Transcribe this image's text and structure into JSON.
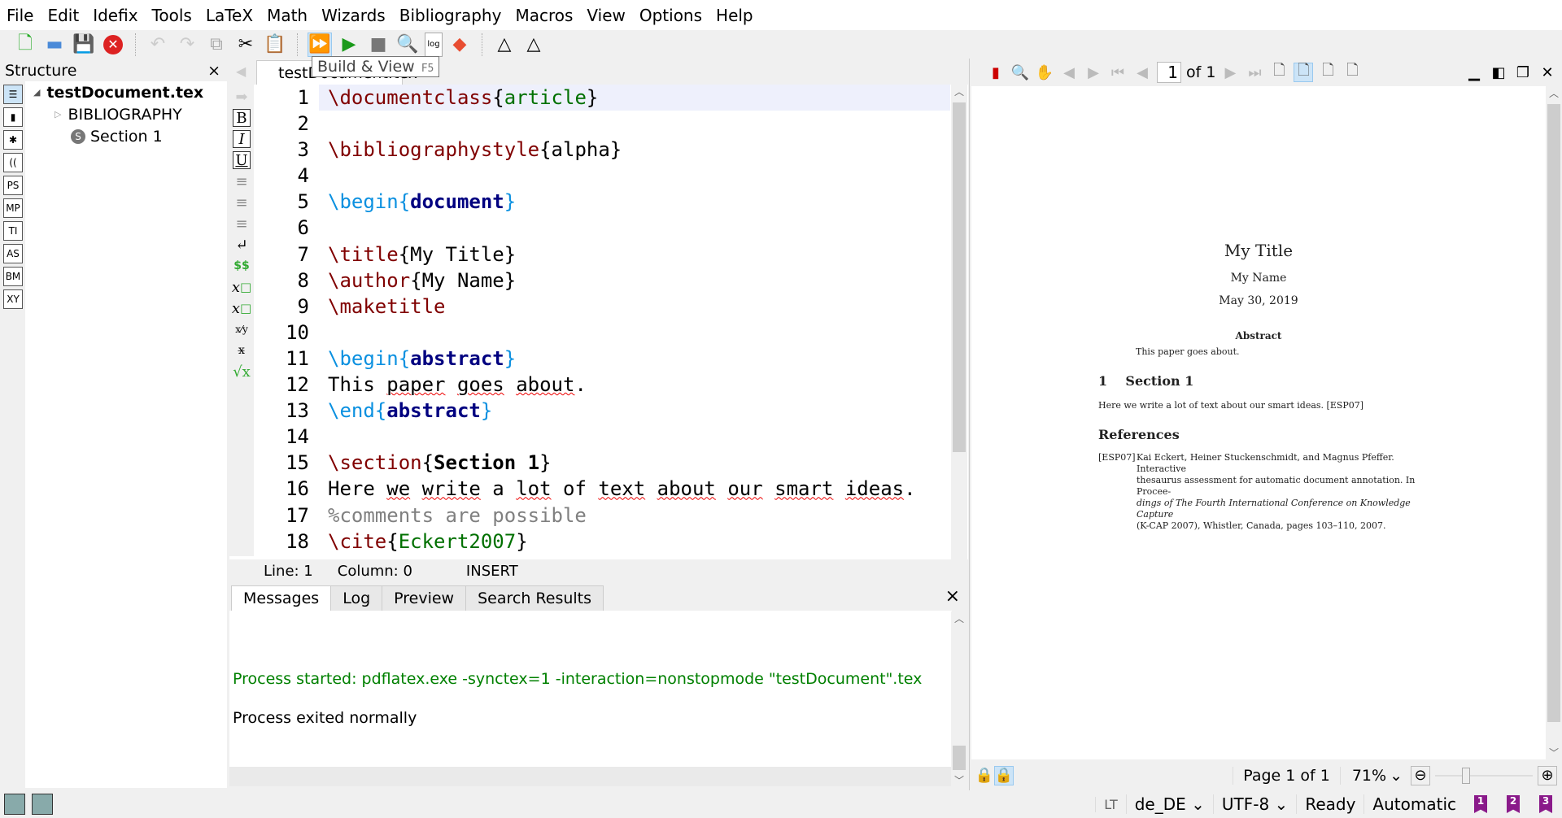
{
  "menu": [
    "File",
    "Edit",
    "Idefix",
    "Tools",
    "LaTeX",
    "Math",
    "Wizards",
    "Bibliography",
    "Macros",
    "View",
    "Options",
    "Help"
  ],
  "tooltip": {
    "label": "Build & View",
    "shortcut": "F5"
  },
  "structure": {
    "title": "Structure",
    "close": "×",
    "side_icons": [
      "PS",
      "MP",
      "TI",
      "AS",
      "BM",
      "XY"
    ],
    "file": "testDocument.tex",
    "items": [
      "BIBLIOGRAPHY",
      "Section 1"
    ]
  },
  "editor": {
    "tab": "testDocument.tex",
    "status": {
      "line": "Line: 1",
      "column": "Column: 0",
      "mode": "INSERT"
    },
    "line_numbers": [
      "1",
      "2",
      "3",
      "4",
      "5",
      "6",
      "7",
      "8",
      "9",
      "10",
      "11",
      "12",
      "13",
      "14",
      "15",
      "16",
      "17",
      "18"
    ]
  },
  "messages": {
    "tabs": [
      "Messages",
      "Log",
      "Preview",
      "Search Results"
    ],
    "close": "×",
    "lines": [
      "Process started: pdflatex.exe -synctex=1 -interaction=nonstopmode \"testDocument\".tex",
      "Process exited normally"
    ],
    "started_color": "#008000"
  },
  "pdf": {
    "page_input": "1",
    "of": "of 1",
    "page_label": "Page 1 of 1",
    "zoom": "71%",
    "zoom_slider_percent": 30,
    "doc": {
      "title": "My Title",
      "author": "My Name",
      "date": "May 30, 2019",
      "abstract_head": "Abstract",
      "abstract": "This paper goes about.",
      "section": "1    Section 1",
      "body": "Here we write a lot of text about our smart ideas. [ESP07]",
      "refs_head": "References",
      "ref_key": "[ESP07]",
      "ref_lines": [
        "Kai Eckert, Heiner Stuckenschmidt, and Magnus Pfeffer. Interactive",
        "thesaurus assessment for automatic document annotation. In Procee-",
        "dings of The Fourth International Conference on Knowledge Capture",
        "(K-CAP 2007), Whistler, Canada, pages 103–110, 2007."
      ]
    }
  },
  "statusbar": {
    "lt": "LT",
    "language": "de_DE",
    "encoding": "UTF-8",
    "state": "Ready",
    "mode": "Automatic",
    "bookmarks": [
      "1",
      "2",
      "3"
    ]
  }
}
